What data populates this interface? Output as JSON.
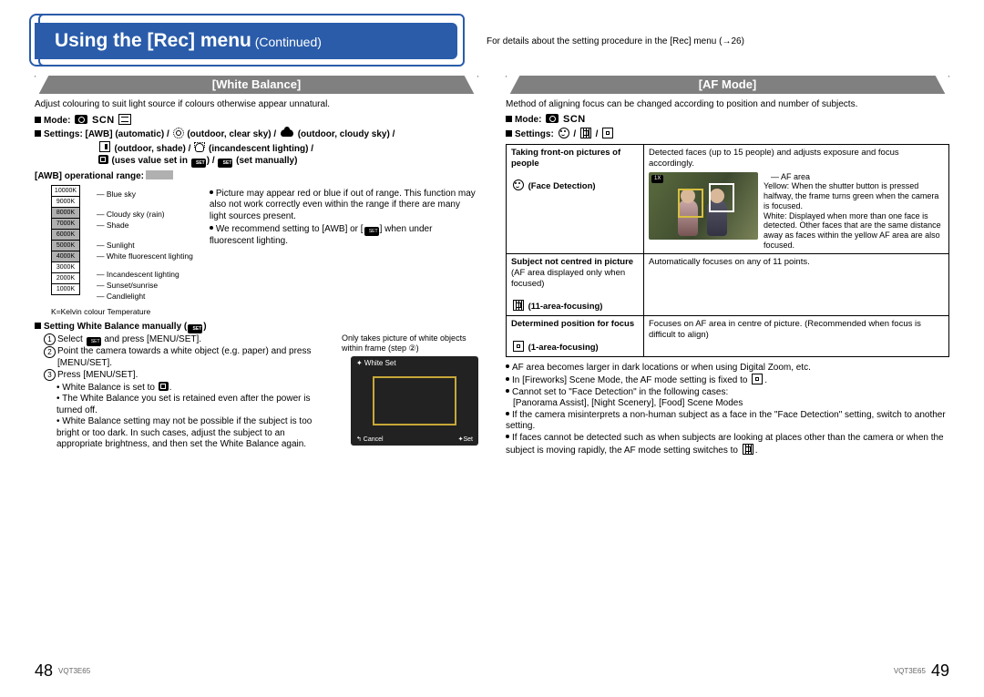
{
  "header": {
    "title_main": "Using the [Rec] menu",
    "title_cont": " (Continued)",
    "details": "For details about the setting procedure in the [Rec] menu (→26)"
  },
  "left": {
    "section_title": "[White Balance]",
    "intro": "Adjust colouring to suit light source if colours otherwise appear unnatural.",
    "mode_label": "Mode:",
    "settings_label": "Settings: [AWB] (automatic) / ",
    "setting_outdoor_clear": " (outdoor, clear sky) / ",
    "setting_outdoor_cloudy": " (outdoor, cloudy sky) /",
    "setting_shade": " (outdoor, shade) / ",
    "setting_incandescent": " (incandescent lighting) /",
    "setting_uses_value": " (uses value set in ",
    "setting_uses_value_end": ") / ",
    "setting_set_manually": " (set manually)",
    "awb_range_label": "[AWB] operational range:",
    "kelvin_values": [
      "10000K",
      "9000K",
      "8000K",
      "7000K",
      "6000K",
      "5000K",
      "4000K",
      "3000K",
      "2000K",
      "1000K"
    ],
    "kelvin_labels": [
      "Blue sky",
      "Cloudy sky (rain)",
      "Shade",
      "Sunlight",
      "White fluorescent lighting",
      "Incandescent lighting",
      "Sunset/sunrise",
      "Candlelight"
    ],
    "kfooter": "K=Kelvin colour Temperature",
    "bullet1": "Picture may appear red or blue if out of range. This function may also not work correctly even within the range if there are many light sources present.",
    "bullet2": "We recommend setting to [AWB] or [",
    "bullet2_end": "] when under fluorescent lighting.",
    "manual_heading": "Setting White Balance manually (",
    "manual_heading_end": ")",
    "m1": "Select ",
    "m1_end": " and press [MENU/SET].",
    "m2": "Point the camera towards a white object (e.g. paper) and press [MENU/SET].",
    "m3": "Press [MENU/SET].",
    "m3_b1": "• White Balance is set to ",
    "m3_b1_end": ".",
    "m3_b2": "• The White Balance you set is retained even after the power is turned off.",
    "m3_b3": "• White Balance setting may not be possible if the subject is too bright or too dark. In such cases, adjust the subject to an appropriate brightness, and then set the White Balance again.",
    "ws_only": "Only takes picture of white objects within frame (step ②)",
    "ws_title": "✦ White Set",
    "ws_cancel": "↰ Cancel",
    "ws_set": "✦Set"
  },
  "right": {
    "section_title": "[AF Mode]",
    "intro": "Method of aligning focus can be changed according to position and number of subjects.",
    "mode_label": "Mode:",
    "settings_label": "Settings:",
    "row1_l1": "Taking front-on pictures of people",
    "row1_l2": "(Face Detection)",
    "row1_r1": "Detected faces (up to 15 people) and adjusts exposure and focus accordingly.",
    "row1_r_af": "AF area",
    "row1_r_y": "Yellow:",
    "row1_r_y_t": "When the shutter button is pressed halfway, the frame turns green when the camera is focused.",
    "row1_r_w": "White:",
    "row1_r_w_t": "Displayed when more than one face is detected. Other faces that are the same distance away as faces within the yellow AF area are also focused.",
    "photo_tag": "1X",
    "row2_l1": "Subject not centred in picture",
    "row2_l2": " (AF area displayed only when focused)",
    "row2_l3": "(11-area-focusing)",
    "row2_r": "Automatically focuses on any of 11 points.",
    "row3_l1": "Determined position for focus",
    "row3_l2": "(1-area-focusing)",
    "row3_r": "Focuses on AF area in centre of picture. (Recommended when focus is difficult to align)",
    "n1": "AF area becomes larger in dark locations or when using Digital Zoom, etc.",
    "n2a": "In [Fireworks] Scene Mode, the AF mode setting is fixed to ",
    "n2b": ".",
    "n3": "Cannot set to \"Face Detection\" in the following cases:",
    "n3b": "[Panorama Assist], [Night Scenery], [Food] Scene Modes",
    "n4": "If the camera misinterprets a non-human subject as a face in the \"Face Detection\" setting, switch to another setting.",
    "n5a": "If faces cannot be detected such as when subjects are looking at places other than the camera or when the subject is moving rapidly, the AF mode setting switches to ",
    "n5b": "."
  },
  "footer": {
    "page_left": "48",
    "page_right": "49",
    "docnum": "VQT3E65"
  }
}
